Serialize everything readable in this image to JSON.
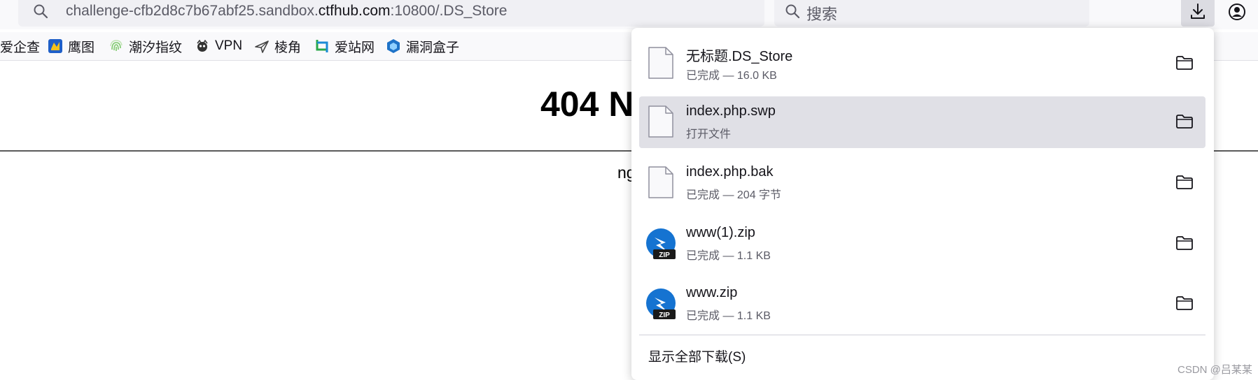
{
  "address_bar": {
    "url_prefix": "challenge-cfb2d8c7b67abf25.sandbox.",
    "url_domain": "ctfhub.com",
    "url_suffix": ":10800/.DS_Store",
    "icon": "search-icon"
  },
  "search_bar": {
    "placeholder": "搜索",
    "icon": "search-icon"
  },
  "toolbar": {
    "downloads_icon": "download-arrow-icon",
    "account_icon": "account-icon"
  },
  "bookmarks": [
    {
      "label": "爱企查",
      "icon": ""
    },
    {
      "label": "鹰图",
      "icon": "hunter-icon"
    },
    {
      "label": "潮汐指纹",
      "icon": "fingerprint-icon"
    },
    {
      "label": "VPN",
      "icon": "vpn-icon"
    },
    {
      "label": "棱角",
      "icon": "edge-icon"
    },
    {
      "label": "爱站网",
      "icon": "aizhan-icon"
    },
    {
      "label": "漏洞盒子",
      "icon": "vulbox-icon"
    }
  ],
  "page": {
    "title": "404 N",
    "server": "ng"
  },
  "downloads": {
    "items": [
      {
        "name": "无标题.DS_Store",
        "status": "已完成 — 16.0 KB",
        "type": "file",
        "highlighted": false
      },
      {
        "name": "index.php.swp",
        "status": "打开文件",
        "type": "file",
        "highlighted": true
      },
      {
        "name": "index.php.bak",
        "status": "已完成 — 204 字节",
        "type": "file",
        "highlighted": false
      },
      {
        "name": "www(1).zip",
        "status": "已完成 — 1.1 KB",
        "type": "zip",
        "highlighted": false
      },
      {
        "name": "www.zip",
        "status": "已完成 — 1.1 KB",
        "type": "zip",
        "highlighted": false
      }
    ],
    "show_all_label": "显示全部下载(S)"
  },
  "watermark": "CSDN @吕某某",
  "colors": {
    "highlight": "#e0e0e6",
    "zip_blue": "#1573d1",
    "panel_bg": "#ffffff"
  }
}
